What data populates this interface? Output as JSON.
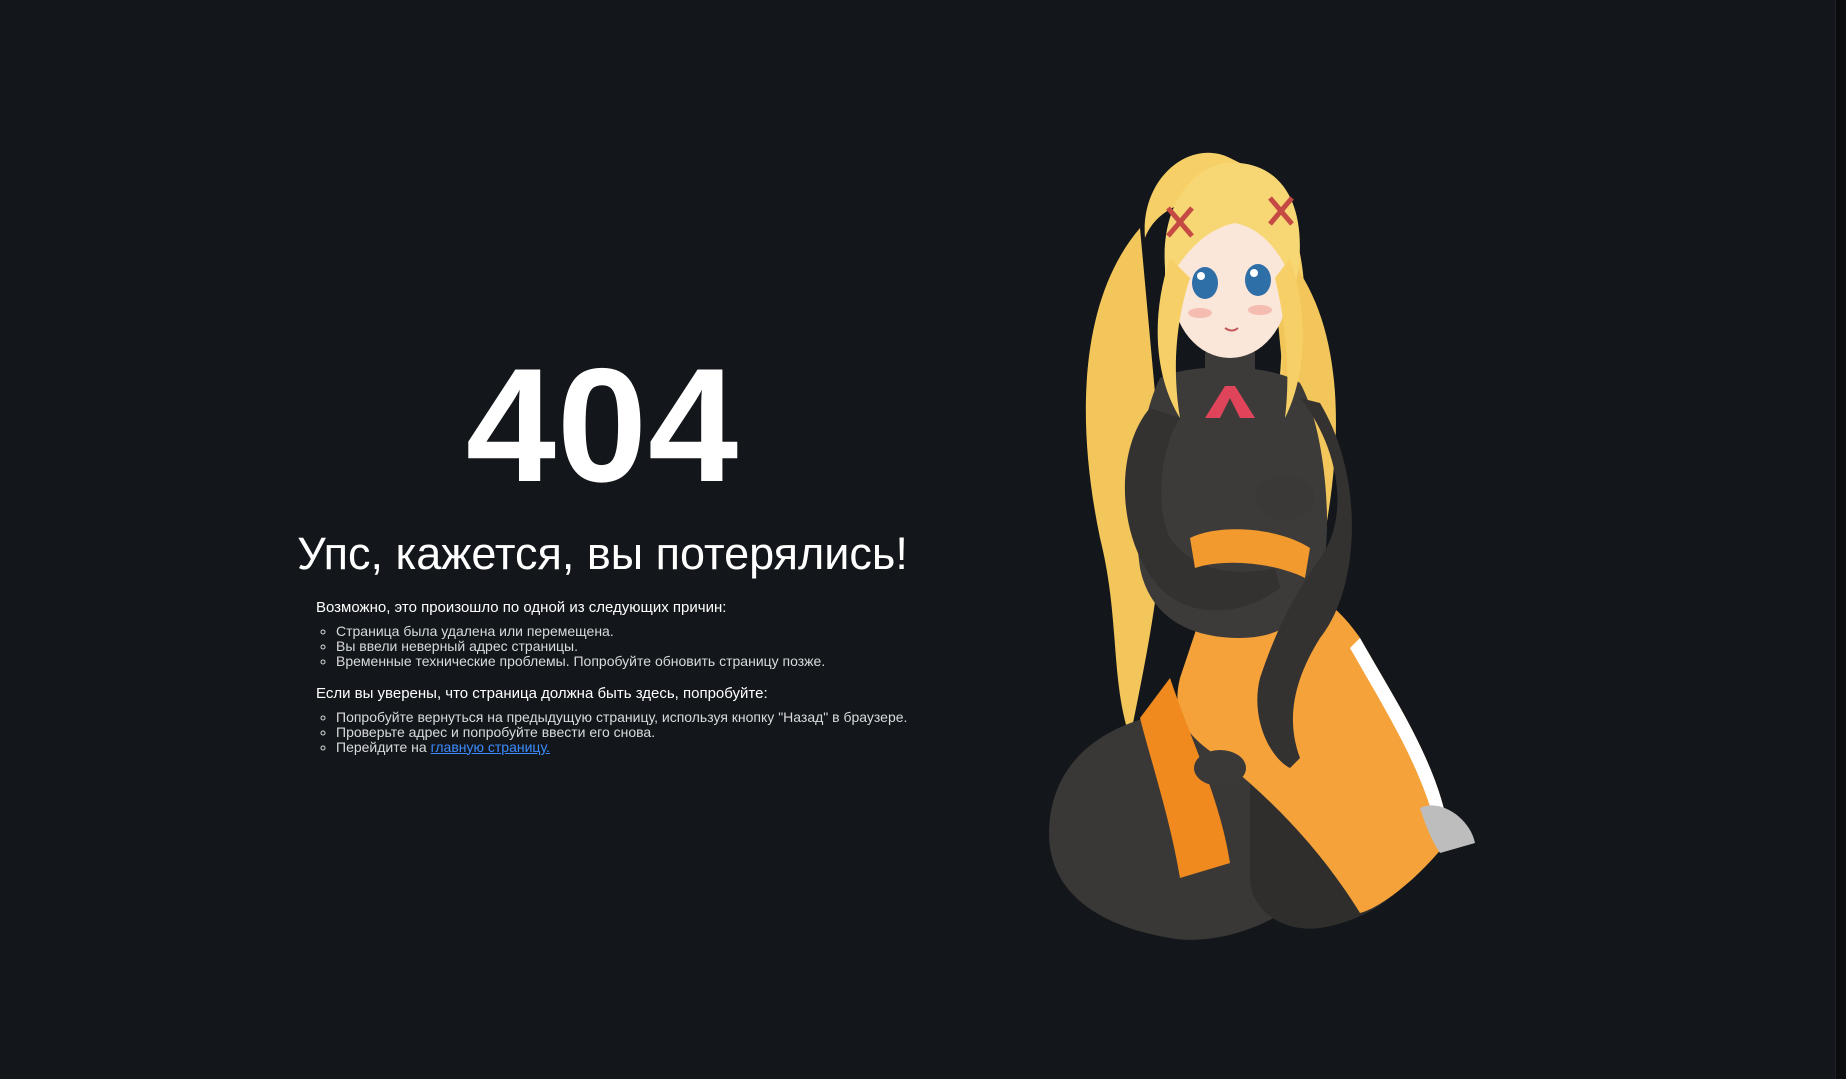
{
  "error": {
    "code": "404",
    "headline": "Упс, кажется, вы потерялись!"
  },
  "reasons": {
    "lead": "Возможно, это произошло по одной из следующих причин:",
    "items": [
      "Страница была удалена или перемещена.",
      "Вы ввели неверный адрес страницы.",
      "Временные технические проблемы. Попробуйте обновить страницу позже."
    ]
  },
  "suggestions": {
    "lead": "Если вы уверены, что страница должна быть здесь, попробуйте:",
    "items": [
      "Попробуйте вернуться на предыдущую страницу, используя кнопку \"Назад\" в браузере.",
      "Проверьте адрес и попробуйте ввести его снова."
    ],
    "last_prefix": "Перейдите на ",
    "home_link_text": "главную страницу."
  },
  "colors": {
    "background": "#13171b",
    "text": "#ffffff",
    "link": "#3b8bff",
    "accent_orange": "#f5a23a",
    "hair": "#f7d774"
  },
  "illustration": {
    "icon": "anime-character-illustration"
  }
}
